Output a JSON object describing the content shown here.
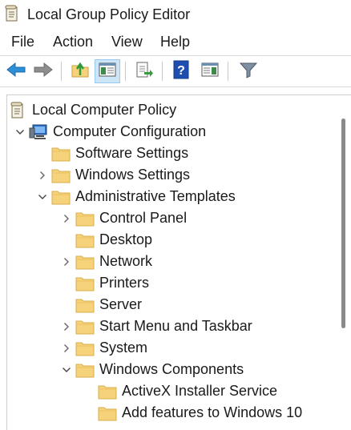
{
  "window": {
    "title": "Local Group Policy Editor"
  },
  "menu": [
    {
      "label": "File"
    },
    {
      "label": "Action"
    },
    {
      "label": "View"
    },
    {
      "label": "Help"
    }
  ],
  "toolbar": {
    "buttons": [
      {
        "name": "back-button",
        "icon": "back-arrow-icon"
      },
      {
        "name": "forward-button",
        "icon": "forward-arrow-icon"
      },
      {
        "name": "up-one-level-button",
        "icon": "folder-up-icon"
      },
      {
        "name": "show-hide-console-tree-button",
        "icon": "console-tree-icon",
        "active": true
      },
      {
        "name": "export-list-button",
        "icon": "export-list-icon"
      },
      {
        "name": "help-button",
        "icon": "help-icon"
      },
      {
        "name": "show-hide-action-pane-button",
        "icon": "action-pane-icon"
      },
      {
        "name": "filter-button",
        "icon": "filter-icon"
      }
    ]
  },
  "tree": [
    {
      "label": "Local Computer Policy",
      "icon": "policy-document-icon",
      "expander": "none",
      "level": 0
    },
    {
      "label": "Computer Configuration",
      "icon": "computer-icon",
      "expander": "expanded",
      "level": 1
    },
    {
      "label": "Software Settings",
      "icon": "folder-icon",
      "expander": "none",
      "level": 2
    },
    {
      "label": "Windows Settings",
      "icon": "folder-icon",
      "expander": "collapsed",
      "level": 2
    },
    {
      "label": "Administrative Templates",
      "icon": "folder-icon",
      "expander": "expanded",
      "level": 2
    },
    {
      "label": "Control Panel",
      "icon": "folder-icon",
      "expander": "collapsed",
      "level": 3
    },
    {
      "label": "Desktop",
      "icon": "folder-icon",
      "expander": "none",
      "level": 3
    },
    {
      "label": "Network",
      "icon": "folder-icon",
      "expander": "collapsed",
      "level": 3
    },
    {
      "label": "Printers",
      "icon": "folder-icon",
      "expander": "none",
      "level": 3
    },
    {
      "label": "Server",
      "icon": "folder-icon",
      "expander": "none",
      "level": 3
    },
    {
      "label": "Start Menu and Taskbar",
      "icon": "folder-icon",
      "expander": "collapsed",
      "level": 3
    },
    {
      "label": "System",
      "icon": "folder-icon",
      "expander": "collapsed",
      "level": 3
    },
    {
      "label": "Windows Components",
      "icon": "folder-icon",
      "expander": "expanded",
      "level": 3
    },
    {
      "label": "ActiveX Installer Service",
      "icon": "folder-icon",
      "expander": "none",
      "level": 4
    },
    {
      "label": "Add features to Windows 10",
      "icon": "folder-icon",
      "expander": "none",
      "level": 4
    }
  ],
  "colors": {
    "folder": "#f6d37a",
    "accent": "#0067c0",
    "selection": "#cde6f7"
  }
}
